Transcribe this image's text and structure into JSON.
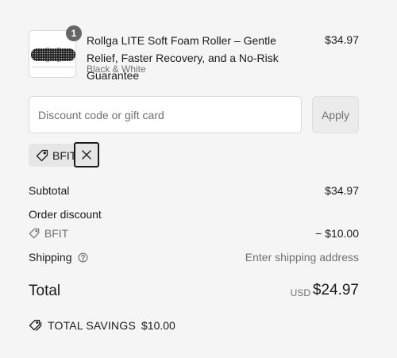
{
  "product": {
    "quantity": "1",
    "title": "Rollga LITE Soft Foam Roller – Gentle Relief, Faster Recovery, and a No-Risk Guarantee",
    "variant": "Black & White",
    "price": "$34.97",
    "image_icon": "foam-roller-image"
  },
  "discount": {
    "placeholder": "Discount code or gift card",
    "value": "",
    "apply_label": "Apply",
    "applied_code": "BFIT"
  },
  "summary": {
    "subtotal_label": "Subtotal",
    "subtotal_value": "$34.97",
    "order_discount_label": "Order discount",
    "discount_code": "BFIT",
    "discount_value": "− $10.00",
    "shipping_label": "Shipping",
    "shipping_value": "Enter shipping address",
    "total_label": "Total",
    "currency": "USD",
    "total_value": "$24.97",
    "savings_label": "TOTAL SAVINGS",
    "savings_value": "$10.00"
  },
  "colors": {
    "background": "#f5f5f5",
    "text": "#1a1a1a",
    "muted": "#707070",
    "badge": "#666666"
  }
}
